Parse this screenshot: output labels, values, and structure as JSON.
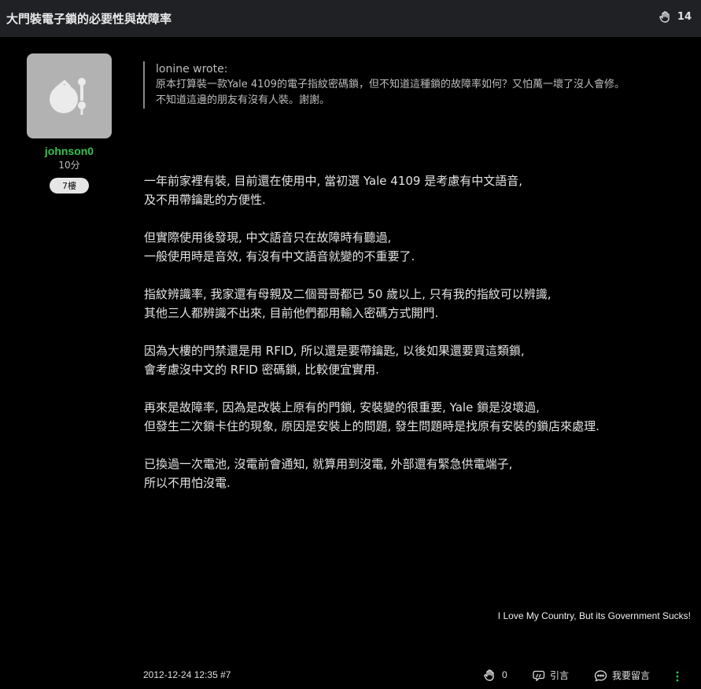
{
  "header": {
    "title": "大門裝電子鎖的必要性與故障率",
    "gp_count": "14"
  },
  "author": {
    "name": "johnson0",
    "score": "10分",
    "floor": "7樓"
  },
  "quote": {
    "who": "lonine wrote:",
    "lines": [
      "原本打算裝一款Yale 4109的電子指紋密碼鎖，但不知道這種鎖的故障率如何？又怕萬一壞了沒人會修。",
      "不知道這邊的朋友有沒有人裝。謝謝。"
    ]
  },
  "post": {
    "paragraphs": [
      [
        "一年前家裡有裝, 目前還在使用中, 當初選 Yale 4109 是考慮有中文語音,",
        "及不用帶鑰匙的方便性."
      ],
      [
        "但實際使用後發現, 中文語音只在故障時有聽過,",
        "一般使用時是音效, 有沒有中文語音就變的不重要了."
      ],
      [
        "指紋辨識率, 我家還有母親及二個哥哥都已 50 歲以上, 只有我的指紋可以辨識,",
        "其他三人都辨識不出來, 目前他們都用輸入密碼方式開門."
      ],
      [
        "因為大樓的門禁還是用 RFID, 所以還是要帶鑰匙, 以後如果還要買這類鎖,",
        "會考慮沒中文的 RFID 密碼鎖, 比較便宜實用."
      ],
      [
        "再來是故障率, 因為是改裝上原有的門鎖, 安裝變的很重要, Yale 鎖是沒壞過,",
        "但發生二次鎖卡住的現象, 原因是安裝上的問題, 發生問題時是找原有安裝的鎖店來處理."
      ],
      [
        "已換過一次電池, 沒電前會通知, 就算用到沒電, 外部還有緊急供電端子,",
        "所以不用怕沒電."
      ]
    ]
  },
  "signature": "I Love My Country, But its Government Sucks!",
  "footer": {
    "datetime": "2012-12-24 12:35 #7",
    "like_count": "0",
    "quote_label": "引言",
    "reply_label": "我要留言"
  },
  "icons": {
    "like": "clap-hand-icon",
    "quote": "quote-bubble-icon",
    "reply": "comment-bubble-icon",
    "more": "more-vertical-icon",
    "avatar": "default-avatar-icon"
  },
  "colors": {
    "accent": "#35c14f",
    "header_bg": "#1f2125",
    "page_bg": "#000000"
  }
}
